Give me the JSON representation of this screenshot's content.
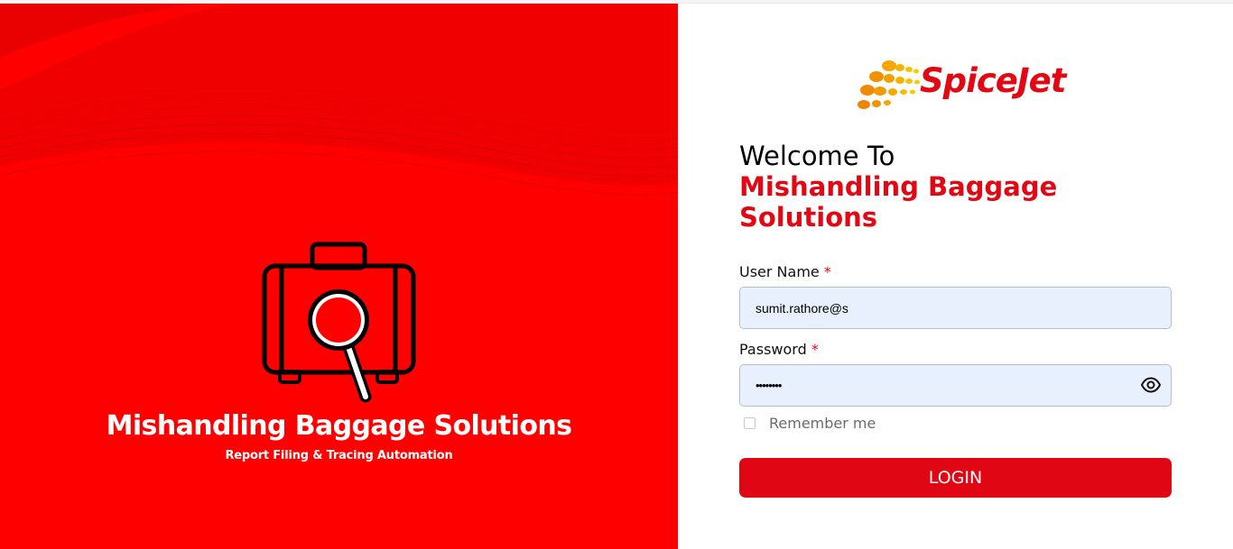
{
  "colors": {
    "brand_red": "#ff0000",
    "accent_red": "#e30613",
    "field_bg": "#e8f0fe"
  },
  "hero": {
    "icon": "suitcase-magnifier-icon",
    "title": "Mishandling Baggage Solutions",
    "subtitle": "Report Filing & Tracing Automation"
  },
  "logo": {
    "text": "SpiceJet",
    "icon": "spicejet-dots-icon"
  },
  "welcome": {
    "line1": "Welcome To",
    "brand": "Mishandling Baggage Solutions"
  },
  "form": {
    "username": {
      "label": "User Name",
      "required_mark": "*",
      "value": "sumit.rathore@s"
    },
    "password": {
      "label": "Password",
      "required_mark": "*",
      "value": "••••••••",
      "toggle_icon": "eye-icon"
    },
    "remember": {
      "label": "Remember me",
      "checked": false
    },
    "submit_label": "LOGIN"
  }
}
